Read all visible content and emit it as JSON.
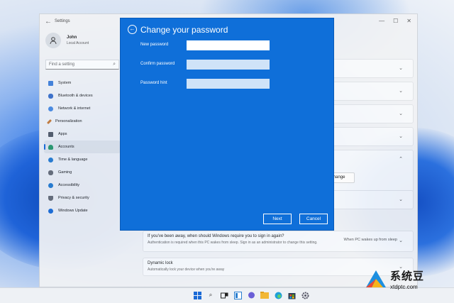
{
  "window": {
    "title": "Settings",
    "controls": [
      "—",
      "☐",
      "✕"
    ]
  },
  "user": {
    "name": "John",
    "account": "Local Account"
  },
  "search": {
    "placeholder": "Find a setting"
  },
  "sidebar": {
    "items": [
      {
        "label": "System",
        "color": "#3f7fd8"
      },
      {
        "label": "Bluetooth & devices",
        "color": "#3a6fc8"
      },
      {
        "label": "Network & internet",
        "color": "#4a8ae0"
      },
      {
        "label": "Personalization",
        "color": "#c97b36"
      },
      {
        "label": "Apps",
        "color": "#555b66"
      },
      {
        "label": "Accounts",
        "color": "#2c9b6a"
      },
      {
        "label": "Time & language",
        "color": "#2a7fd0"
      },
      {
        "label": "Gaming",
        "color": "#6b6f76"
      },
      {
        "label": "Accessibility",
        "color": "#2a7fd0"
      },
      {
        "label": "Privacy & security",
        "color": "#6b6f76"
      },
      {
        "label": "Windows Update",
        "color": "#1f6fd6"
      }
    ],
    "selected": "Accounts"
  },
  "main": {
    "change_label": "Change",
    "signin_card": {
      "title": "If you've been away, when should Windows require you to sign in again?",
      "desc": "Authentication is required when this PC wakes from sleep. Sign in as an administrator to change this setting.",
      "value": "When PC wakes up from sleep"
    },
    "dynamic_lock": {
      "title": "Dynamic lock",
      "desc": "Automatically lock your device when you're away"
    }
  },
  "dialog": {
    "title": "Change your password",
    "fields": {
      "new_password": {
        "label": "New password",
        "value": ""
      },
      "confirm_password": {
        "label": "Confirm password",
        "value": ""
      },
      "password_hint": {
        "label": "Password hint",
        "value": ""
      }
    },
    "next_label": "Next",
    "cancel_label": "Cancel",
    "background_color": "#0f6fd9"
  },
  "watermark": {
    "name": "系统豆",
    "url": "xtdptc.com"
  },
  "colors": {
    "accent": "#1a6ad6",
    "dialog_blue": "#0f6fd9"
  }
}
